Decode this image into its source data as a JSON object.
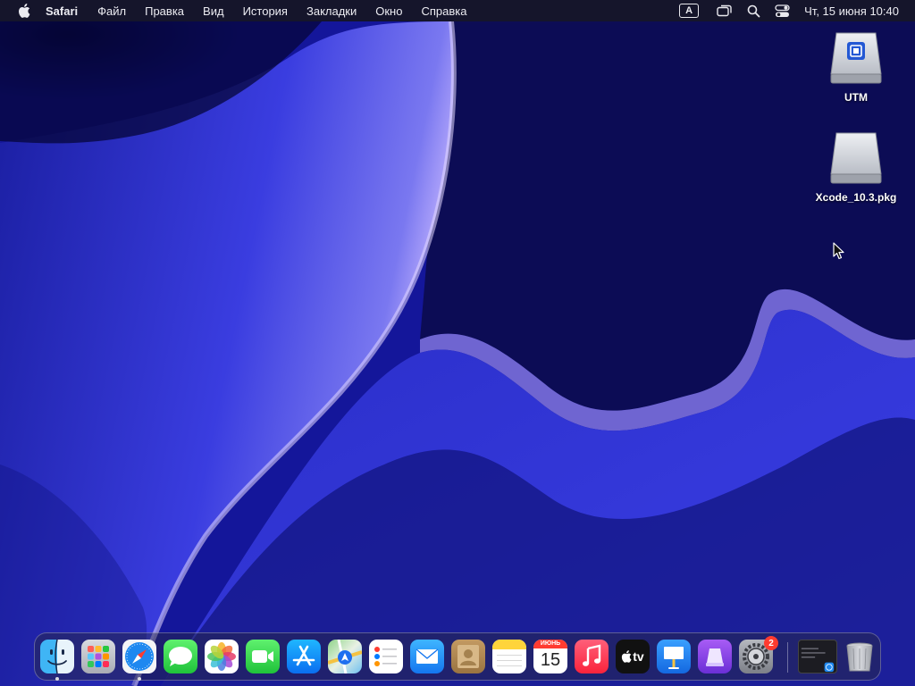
{
  "menubar": {
    "app_name": "Safari",
    "menus": [
      "Файл",
      "Правка",
      "Вид",
      "История",
      "Закладки",
      "Окно",
      "Справка"
    ],
    "input_source": "A",
    "clock": "Чт, 15 июня  10:40",
    "icons": [
      "apple-icon",
      "keyboard-input-icon",
      "screen-mirroring-icon",
      "spotlight-search-icon",
      "control-center-icon"
    ]
  },
  "desktop": {
    "icons": [
      {
        "label": "UTM",
        "icon": "disk-image-icon"
      },
      {
        "label": "Xcode_10.3.pkg",
        "icon": "disk-image-icon"
      }
    ]
  },
  "dock": {
    "apps": [
      {
        "name": "finder",
        "icon": "finder-icon",
        "running": true
      },
      {
        "name": "launchpad",
        "icon": "launchpad-icon",
        "running": false
      },
      {
        "name": "safari",
        "icon": "safari-icon",
        "running": true
      },
      {
        "name": "messages",
        "icon": "messages-icon",
        "running": false
      },
      {
        "name": "photos",
        "icon": "photos-icon",
        "running": false
      },
      {
        "name": "facetime",
        "icon": "facetime-icon",
        "running": false
      },
      {
        "name": "app-store",
        "icon": "app-store-icon",
        "running": false
      },
      {
        "name": "maps",
        "icon": "maps-icon",
        "running": false
      },
      {
        "name": "reminders",
        "icon": "reminders-icon",
        "running": false
      },
      {
        "name": "mail",
        "icon": "mail-icon",
        "running": false
      },
      {
        "name": "contacts",
        "icon": "contacts-icon",
        "running": false
      },
      {
        "name": "notes",
        "icon": "notes-icon",
        "running": false
      },
      {
        "name": "calendar",
        "icon": "calendar-icon",
        "running": false
      },
      {
        "name": "music",
        "icon": "music-icon",
        "running": false
      },
      {
        "name": "apple-tv",
        "icon": "apple-tv-icon",
        "running": false
      },
      {
        "name": "keynote",
        "icon": "keynote-icon",
        "running": false
      },
      {
        "name": "utm",
        "icon": "utm-icon",
        "running": false
      },
      {
        "name": "system-settings",
        "icon": "system-settings-icon",
        "running": false
      }
    ],
    "calendar": {
      "month": "ИЮНЬ",
      "day": "15"
    },
    "apple_tv_label": "tv",
    "settings_badge": "2",
    "right": [
      {
        "name": "terminal-window-thumbnail",
        "icon": "window-thumbnail-icon"
      },
      {
        "name": "trash",
        "icon": "trash-icon"
      }
    ]
  },
  "colors": {
    "menubar_bg": "#161622",
    "accent_blue": "#2d2fd6",
    "badge_red": "#ff3b30"
  }
}
